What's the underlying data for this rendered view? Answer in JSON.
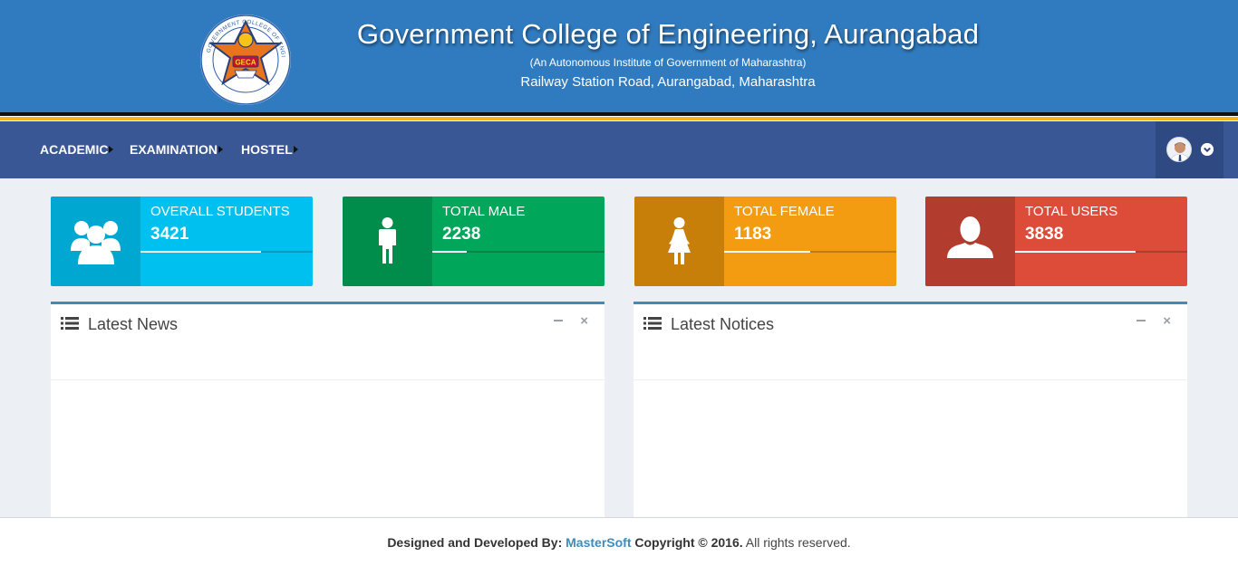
{
  "header": {
    "title": "Government College of Engineering, Aurangabad",
    "subtitle": "(An Autonomous Institute of Government of Maharashtra)",
    "address": "Railway Station Road, Aurangabad, Maharashtra",
    "logo_text": "GOVERNMENT COLLEGE OF ENGINEERING AURANGABAD",
    "logo_abbr": "GECA"
  },
  "nav": {
    "items": [
      {
        "label": "ACADEMIC"
      },
      {
        "label": "EXAMINATION"
      },
      {
        "label": "HOSTEL"
      }
    ],
    "user_icon": "avatar",
    "menu_icon": "chevron-down-icon"
  },
  "stats": [
    {
      "label": "OVERALL STUDENTS",
      "value": "3421",
      "icon": "users-group-icon",
      "color": "#00c0ef",
      "icon_bg": "#00a7d0",
      "progress": 0.7
    },
    {
      "label": "TOTAL MALE",
      "value": "2238",
      "icon": "male-icon",
      "color": "#00a65a",
      "icon_bg": "#008d4c",
      "progress": 0.2
    },
    {
      "label": "TOTAL FEMALE",
      "value": "1183",
      "icon": "female-icon",
      "color": "#f39c12",
      "icon_bg": "#c87f0a",
      "progress": 0.5
    },
    {
      "label": "TOTAL USERS",
      "value": "3838",
      "icon": "user-icon",
      "color": "#dd4b39",
      "icon_bg": "#b23c2e",
      "progress": 0.7
    }
  ],
  "panels": [
    {
      "title": "Latest News"
    },
    {
      "title": "Latest Notices"
    }
  ],
  "footer": {
    "prefix": "Designed and Developed By: ",
    "brand": "MasterSoft",
    "copyright": " Copyright © 2016.",
    "rights": " All rights reserved."
  }
}
